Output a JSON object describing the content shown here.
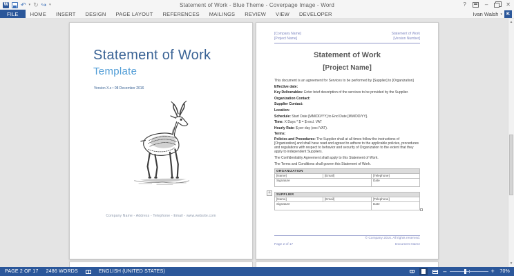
{
  "window": {
    "title": "Statement of Work - Blue Theme - Coverpage Image - Word",
    "user_name": "Ivan Walsh",
    "avatar_initial": "K"
  },
  "icons": {
    "help": "?",
    "minimize": "–",
    "close": "✕",
    "undo": "↶",
    "redo": "↻",
    "repeat": "↪",
    "qat_dropdown": "▾",
    "user_caret": "▾",
    "scroll_up": "▲",
    "scroll_down": "▼",
    "zoom_out": "–",
    "zoom_in": "+",
    "table_handle": "+"
  },
  "ribbon": {
    "tabs": [
      {
        "label": "FILE",
        "active": true
      },
      {
        "label": "HOME",
        "active": false
      },
      {
        "label": "INSERT",
        "active": false
      },
      {
        "label": "DESIGN",
        "active": false
      },
      {
        "label": "PAGE LAYOUT",
        "active": false
      },
      {
        "label": "REFERENCES",
        "active": false
      },
      {
        "label": "MAILINGS",
        "active": false
      },
      {
        "label": "REVIEW",
        "active": false
      },
      {
        "label": "VIEW",
        "active": false
      },
      {
        "label": "DEVELOPER",
        "active": false
      }
    ]
  },
  "cover_page": {
    "title": "Statement of Work",
    "subtitle": "Template",
    "version_line": "Version X.x • 08 December 2016",
    "footer": "Company Name - Address - Telephone - Email - www.website.com"
  },
  "document_page": {
    "header": {
      "company": "[Company Name]",
      "project": "[Project Name]",
      "doc_title": "Statement of Work",
      "version": "[Version Number]"
    },
    "heading": "Statement of Work",
    "subheading": "[Project Name]",
    "intro": "This document is an agreement for Services to be performed by [Supplier] to [Organization]",
    "fields": [
      {
        "label": "Effective date:",
        "text": ""
      },
      {
        "label": "Key Deliverables:",
        "text": " Enter brief description of the services to be provided by the Supplier."
      },
      {
        "label": "Organization Contact:",
        "text": ""
      },
      {
        "label": "Supplier Contact:",
        "text": ""
      },
      {
        "label": "Location:",
        "text": ""
      },
      {
        "label": "Schedule:",
        "text": " Start Date [MM/DD/YY] to End Date [MM/DD/YY]."
      },
      {
        "label": "Time:",
        "text": " X Days * $ = $ excl. VAT"
      },
      {
        "label": "Hourly Rate:",
        "text": " $ per day (excl VAT)."
      },
      {
        "label": "Terms:",
        "text": ""
      },
      {
        "label": "Policies and Procedures:",
        "text": " The Supplier shall at all times follow the instructions of [Organization] and shall have read and agreed to adhere to the applicable policies, procedures and regulations with respect to behavior and security of Organization to the extent that they apply to independent Suppliers."
      }
    ],
    "closing": [
      "The Confidentiality Agreement shall apply to this Statement of Work.",
      "The Terms and Conditions shall govern this Statement of Work."
    ],
    "tables": [
      {
        "title": "ORGANIZATION",
        "name": "[Name]",
        "email": "[Email]",
        "telephone": "[Telephone]",
        "signature": "Signature",
        "date": "Date"
      },
      {
        "title": "SUPPLIER",
        "name": "[Name]",
        "email": "[Email]",
        "telephone": "[Telephone]",
        "signature": "Signature",
        "date": "Date"
      }
    ],
    "footer": {
      "copyright": "© Company 2016. All rights reserved.",
      "page": "Page 2 of 17",
      "doc_name": "Document Name"
    }
  },
  "status_bar": {
    "page": "PAGE 2 OF 17",
    "words": "2486 WORDS",
    "language": "ENGLISH (UNITED STATES)",
    "zoom_level": "70%"
  },
  "colors": {
    "accent": "#2b579a",
    "cover_title": "#3a6395",
    "cover_subtitle": "#4f9cd6",
    "doc_meta_blue": "#7d86c1",
    "heading_gray": "#595959",
    "table_header_bg": "#dcdcdc"
  }
}
